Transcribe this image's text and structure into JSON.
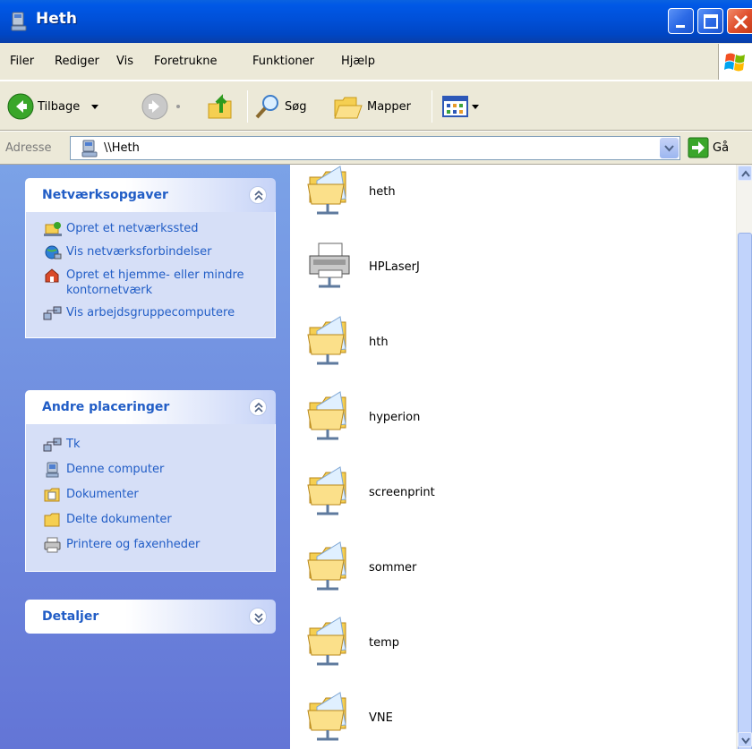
{
  "window": {
    "title": "Heth"
  },
  "menu": [
    "Filer",
    "Rediger",
    "Vis",
    "Foretrukne",
    "Funktioner",
    "Hjælp"
  ],
  "toolbar": {
    "back": "Tilbage",
    "search": "Søg",
    "folders": "Mapper"
  },
  "address": {
    "label": "Adresse",
    "value": "\\\\Heth",
    "go": "Gå"
  },
  "taskpane": {
    "network_tasks": {
      "title": "Netværksopgaver",
      "items": [
        {
          "label": "Opret et netværkssted",
          "icon": "add-network-place-icon"
        },
        {
          "label": "Vis netværksforbindelser",
          "icon": "network-connections-icon"
        },
        {
          "label": "Opret et hjemme- eller mindre kontornetværk",
          "icon": "home-network-icon"
        },
        {
          "label": "Vis arbejdsgruppecomputere",
          "icon": "workgroup-icon"
        }
      ]
    },
    "other_places": {
      "title": "Andre placeringer",
      "items": [
        {
          "label": "Tk",
          "icon": "workgroup-icon"
        },
        {
          "label": "Denne computer",
          "icon": "my-computer-icon"
        },
        {
          "label": "Dokumenter",
          "icon": "documents-icon"
        },
        {
          "label": "Delte dokumenter",
          "icon": "shared-documents-icon"
        },
        {
          "label": "Printere og faxenheder",
          "icon": "printers-icon"
        }
      ]
    },
    "details": {
      "title": "Detaljer"
    }
  },
  "shares": [
    {
      "name": "heth",
      "type": "folder"
    },
    {
      "name": "HPLaserJ",
      "type": "printer"
    },
    {
      "name": "hth",
      "type": "folder"
    },
    {
      "name": "hyperion",
      "type": "folder"
    },
    {
      "name": "screenprint",
      "type": "folder"
    },
    {
      "name": "sommer",
      "type": "folder"
    },
    {
      "name": "temp",
      "type": "folder"
    },
    {
      "name": "VNE",
      "type": "folder"
    }
  ],
  "colors": {
    "titlebar": "#0054e3",
    "taskpane": "#7ba2e7",
    "link": "#215dc6"
  }
}
